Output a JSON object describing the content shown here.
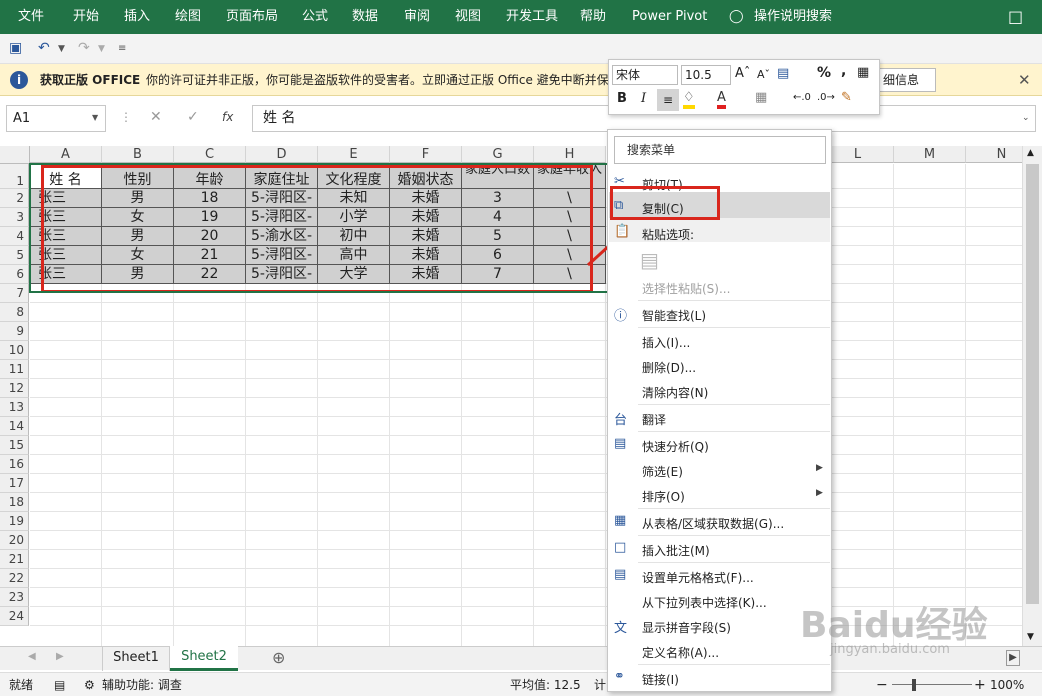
{
  "ribbon": {
    "tabs": [
      "文件",
      "开始",
      "插入",
      "绘图",
      "页面布局",
      "公式",
      "数据",
      "审阅",
      "视图",
      "开发工具",
      "帮助",
      "Power Pivot",
      "操作说明搜索"
    ]
  },
  "notice": {
    "title": "获取正版 OFFICE",
    "message": "你的许可证并非正版，你可能是盗版软件的受害者。立即通过正版 Office 避免中断并保",
    "more": "细信息"
  },
  "formula_bar": {
    "name_box": "A1",
    "fx": "fx",
    "content": "姓 名"
  },
  "mini_toolbar": {
    "font": "宋体",
    "size": "10.5",
    "bold": "B",
    "italic": "I",
    "percent": "%",
    "comma": ","
  },
  "grid": {
    "columns": [
      "A",
      "B",
      "C",
      "D",
      "E",
      "F",
      "G",
      "H",
      "L",
      "M",
      "N"
    ],
    "rows": [
      "1",
      "2",
      "3",
      "4",
      "5",
      "6",
      "7",
      "8",
      "9",
      "10",
      "11",
      "12",
      "13",
      "14",
      "15",
      "16",
      "17",
      "18",
      "19",
      "20",
      "21",
      "22",
      "23",
      "24"
    ],
    "header": [
      "姓 名",
      "性别",
      "年龄",
      "家庭住址",
      "文化程度",
      "婚姻状态",
      "家庭人口数",
      "家庭年收入"
    ],
    "data": [
      [
        "张三",
        "男",
        "18",
        "5-浔阳区-",
        "未知",
        "未婚",
        "3",
        "\\"
      ],
      [
        "张三",
        "女",
        "19",
        "5-浔阳区-",
        "小学",
        "未婚",
        "4",
        "\\"
      ],
      [
        "张三",
        "男",
        "20",
        "5-渝水区-",
        "初中",
        "未婚",
        "5",
        "\\"
      ],
      [
        "张三",
        "女",
        "21",
        "5-浔阳区-",
        "高中",
        "未婚",
        "6",
        "\\"
      ],
      [
        "张三",
        "男",
        "22",
        "5-浔阳区-",
        "大学",
        "未婚",
        "7",
        "\\"
      ]
    ]
  },
  "context_menu": {
    "search_placeholder": "搜索菜单",
    "items": [
      "剪切(T)",
      "复制(C)",
      "粘贴选项:",
      "选择性粘贴(S)...",
      "智能查找(L)",
      "插入(I)...",
      "删除(D)...",
      "清除内容(N)",
      "翻译",
      "快速分析(Q)",
      "筛选(E)",
      "排序(O)",
      "从表格/区域获取数据(G)...",
      "插入批注(M)",
      "设置单元格格式(F)...",
      "从下拉列表中选择(K)...",
      "显示拼音字段(S)",
      "定义名称(A)...",
      "链接(I)"
    ]
  },
  "sheets": {
    "tabs": [
      "Sheet1",
      "Sheet2"
    ],
    "active": "Sheet2"
  },
  "status": {
    "ready": "就绪",
    "accessibility": "辅助功能: 调查",
    "average": "平均值: 12.5",
    "count_cut": "计",
    "zoom": "100%"
  },
  "watermark": {
    "brand": "Baidu经验",
    "url": "jingyan.baidu.com"
  },
  "colors": {
    "accent": "#217346",
    "highlight": "#e02020"
  }
}
